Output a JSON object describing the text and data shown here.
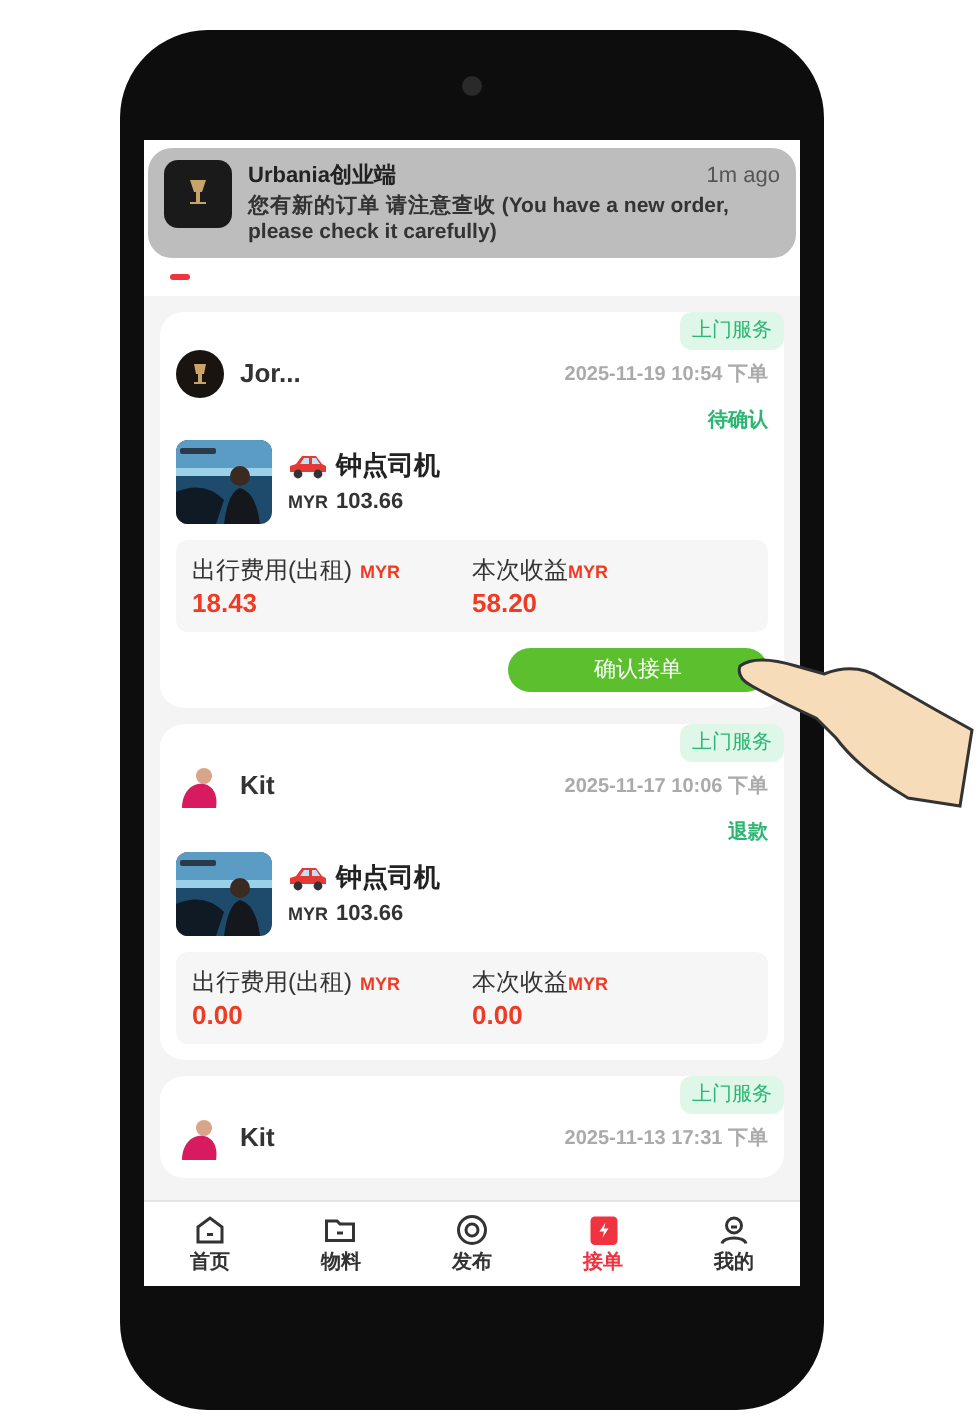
{
  "notification": {
    "app": "Urbania创业端",
    "time": "1m ago",
    "message": "您有新的订单 请注意查收 (You have a new order, please check it carefully)"
  },
  "orders": [
    {
      "name": "Jor...",
      "tag": "上门服务",
      "time": "2025-11-19 10:54 下单",
      "status": "待确认",
      "title": "钟点司机",
      "price_currency": "MYR",
      "price": "103.66",
      "fee_label": "出行费用(出租)",
      "fee_currency": "MYR",
      "fee": "18.43",
      "income_label": "本次收益",
      "income_currency": "MYR",
      "income": "58.20",
      "action": "确认接单"
    },
    {
      "name": "Kit",
      "tag": "上门服务",
      "time": "2025-11-17 10:06 下单",
      "status": "退款",
      "title": "钟点司机",
      "price_currency": "MYR",
      "price": "103.66",
      "fee_label": "出行费用(出租)",
      "fee_currency": "MYR",
      "fee": "0.00",
      "income_label": "本次收益",
      "income_currency": "MYR",
      "income": "0.00"
    },
    {
      "name": "Kit",
      "tag": "上门服务",
      "time": "2025-11-13 17:31 下单"
    }
  ],
  "nav": [
    {
      "label": "首页",
      "selected": false
    },
    {
      "label": "物料",
      "selected": false
    },
    {
      "label": "发布",
      "selected": false
    },
    {
      "label": "接单",
      "selected": true
    },
    {
      "label": "我的",
      "selected": false
    }
  ]
}
